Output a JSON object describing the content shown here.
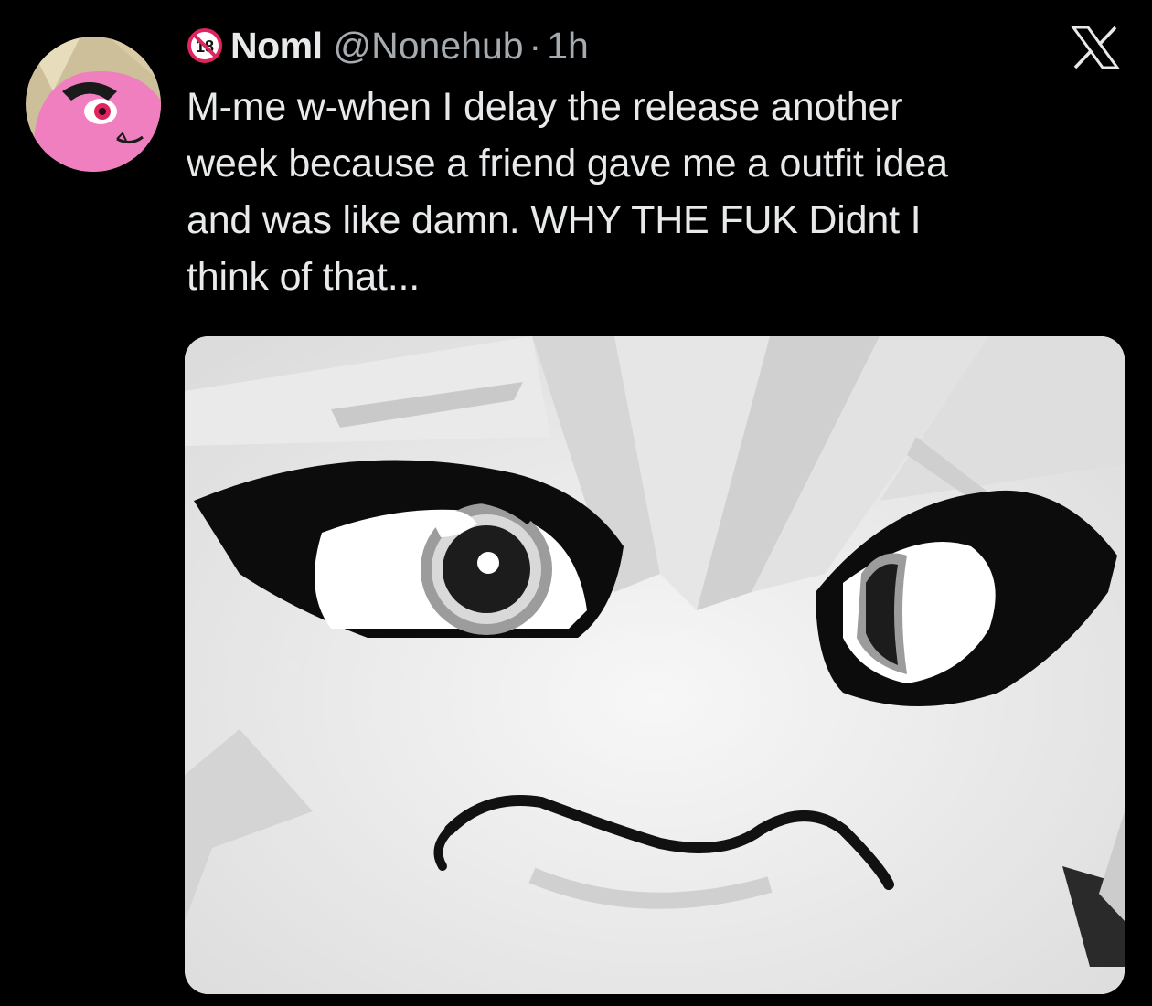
{
  "tweet": {
    "author": {
      "avatar_icon": "avatar-pink-character-icon",
      "badge_icon": "age-18-restricted-icon",
      "display_name": "Noml",
      "handle": "@Nonehub",
      "separator": "·",
      "timestamp": "1h"
    },
    "close_icon": "x-logo-icon",
    "text": "M-me w-when I delay the release another\nweek because a friend gave me a outfit idea\nand was like damn. WHY THE FUK Didnt I\nthink of that...",
    "media": {
      "icon": "grayscale-angry-character-face-image"
    }
  },
  "colors": {
    "background": "#000000",
    "text_primary": "#e7e9ea",
    "text_secondary": "#a6abb0",
    "badge_red": "#e0245e",
    "avatar_pink": "#f07fc0"
  }
}
